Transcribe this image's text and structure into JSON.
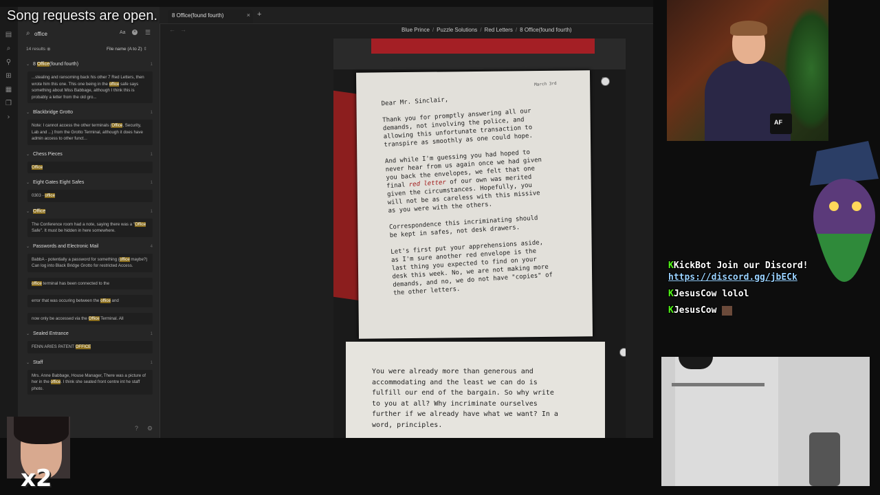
{
  "overlay": {
    "song_banner": "Song requests are open.",
    "multiplier": "x2"
  },
  "tab": {
    "label": "8 Office(found fourth)",
    "close_glyph": "×",
    "new_glyph": "+"
  },
  "breadcrumb": [
    "Blue Prince",
    "Puzzle Solutions",
    "Red Letters",
    "8 Office(found fourth)"
  ],
  "search": {
    "value": "office",
    "match_case_label": "Aa",
    "results_count": "14 results",
    "sort_label": "File name (A to Z)"
  },
  "results": [
    {
      "title_pre": "8 ",
      "title_hl": "Office",
      "title_post": "(found fourth)",
      "count": "1",
      "snippets": [
        {
          "pre": "...stealing and ransoming back his other 7 Red Letters, then wrote him this one. This one being in the ",
          "hl": "office",
          "post": " safe says something about Miss Babbage, although I think this is probably a letter from the old gro..."
        }
      ]
    },
    {
      "title_pre": "Blackbridge Grotto",
      "title_hl": "",
      "title_post": "",
      "count": "1",
      "snippets": [
        {
          "pre": "Note: I cannot access the other terminals (",
          "hl": "Office",
          "post": ", Security, Lab and ...) from the Grotto Terminal, although it does have admin access to other funct..."
        }
      ]
    },
    {
      "title_pre": "Chess Pieces",
      "title_hl": "",
      "title_post": "",
      "count": "1",
      "snippets": [
        {
          "pre": "",
          "hl": "Office",
          "post": ""
        }
      ]
    },
    {
      "title_pre": "Eight Gates Eight Safes",
      "title_hl": "",
      "title_post": "",
      "count": "1",
      "snippets": [
        {
          "pre": "0303 - ",
          "hl": "office",
          "post": ""
        }
      ]
    },
    {
      "title_pre": "",
      "title_hl": "Office",
      "title_post": "",
      "count": "1",
      "snippets": [
        {
          "pre": "The Conference room had a note, saying there was a \"",
          "hl": "Office",
          "post": " Safe\". It must be hidden in here somewhere."
        }
      ]
    },
    {
      "title_pre": "Passwords and Electronic Mail",
      "title_hl": "",
      "title_post": "",
      "count": "4",
      "snippets": [
        {
          "pre": "BabbA - potentially a password for something (",
          "hl": "office",
          "post": " maybe?) Can log into Black Bridge Grotto for restricted Access."
        },
        {
          "pre": "",
          "hl": "office",
          "post": " terminal has been connected to the"
        },
        {
          "pre": "error that was occuring between the ",
          "hl": "office",
          "post": " and"
        },
        {
          "pre": "now only be accessed via the ",
          "hl": "Office",
          "post": " Terminal. All"
        }
      ]
    },
    {
      "title_pre": "Sealed Entrance",
      "title_hl": "",
      "title_post": "",
      "count": "1",
      "snippets": [
        {
          "pre": "FENN ARIES PATENT ",
          "hl": "OFFICE",
          "post": ""
        }
      ]
    },
    {
      "title_pre": "Staff",
      "title_hl": "",
      "title_post": "",
      "count": "1",
      "snippets": [
        {
          "pre": "Mrs. Anne Babbage, House Manager, There was a picture of her in the ",
          "hl": "office",
          "post": ". I think she seated front centre int he staff photo."
        }
      ]
    }
  ],
  "letter": {
    "date": "March 3rd",
    "page_badge": "2",
    "salutation": "Dear Mr. Sinclair,",
    "p1": "Thank you for promptly answering all our\ndemands, not involving the police, and\nallowing this unfortunate transaction to\ntranspire as smoothly as one could hope.",
    "p2_pre": "And while I'm guessing you had hoped to\nnever hear from us again once we had given\nyou back the envelopes, we felt that one\nfinal ",
    "p2_red": "red letter",
    "p2_post": " of our own was merited\ngiven the circumstances. Hopefully, you\nwill not be as careless with this missive\nas you were with the others.",
    "p3": "Correspondence this incriminating should\nbe kept in safes, not desk drawers.",
    "p4": "Let's first put your apprehensions aside,\nas I'm sure another red envelope is the\nlast thing you expected to find on your\ndesk this week. No, we are not making more\ndemands, and no, we do not have \"copies\" of\nthe other letters.",
    "page2": "You were already more than generous and\naccommodating and the least we can do is\nfulfill our end of the bargain. So why write\nto you at all? Why incriminate ourselves\nfurther if we already have what we want? In a\nword, principles."
  },
  "chat": [
    {
      "user": "KickBot",
      "message": "Join our Discord!",
      "link": "https://discord.gg/jbECk"
    },
    {
      "user": "JesusCow",
      "message": "lolol",
      "link": ""
    },
    {
      "user": "JesusCow",
      "message": "",
      "link": ""
    }
  ],
  "webcam": {
    "mug_label": "AF"
  },
  "colors": {
    "highlight": "#8a6d1c",
    "chat_badge": "#53fc18",
    "envelope_red": "#a41f25"
  }
}
